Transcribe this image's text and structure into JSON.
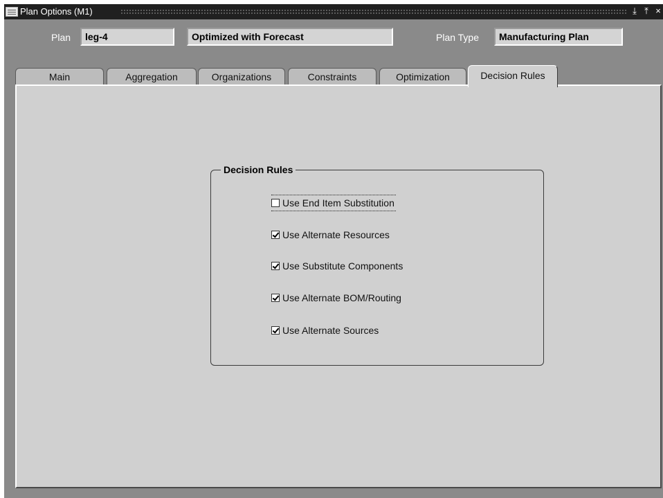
{
  "window": {
    "title": "Plan Options (M1)",
    "controls": {
      "minimize": "⤓",
      "maximize": "⤒",
      "close": "×"
    }
  },
  "header": {
    "plan_label": "Plan",
    "plan_value": "leg-4",
    "plan_desc": "Optimized with Forecast",
    "plan_type_label": "Plan Type",
    "plan_type_value": "Manufacturing Plan"
  },
  "tabs": [
    {
      "label": "Main",
      "active": false
    },
    {
      "label": "Aggregation",
      "active": false
    },
    {
      "label": "Organizations",
      "active": false
    },
    {
      "label": "Constraints",
      "active": false
    },
    {
      "label": "Optimization",
      "active": false
    },
    {
      "label": "Decision Rules",
      "active": true
    }
  ],
  "decision_rules": {
    "title": "Decision Rules",
    "options": [
      {
        "label": "Use End Item Substitution",
        "checked": false,
        "focused": true
      },
      {
        "label": "Use Alternate Resources",
        "checked": true,
        "focused": false
      },
      {
        "label": "Use Substitute Components",
        "checked": true,
        "focused": false
      },
      {
        "label": "Use Alternate BOM/Routing",
        "checked": true,
        "focused": false
      },
      {
        "label": "Use Alternate Sources",
        "checked": true,
        "focused": false
      }
    ]
  }
}
